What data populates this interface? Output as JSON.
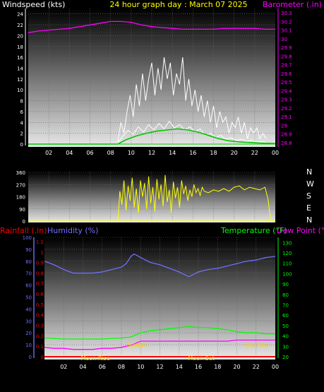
{
  "title": "24 hour graph day : March 07 2025",
  "colors": {
    "background": "#000000",
    "title": "#ffff00",
    "barometer": "#ff00ff",
    "windspeed": "#ffffff",
    "gust": "#ffffff",
    "avg_wind": "#00c800",
    "winddir": "#ffff00",
    "rainfall": "#ff0000",
    "humidity": "#6f6fff",
    "temperature": "#00ff00",
    "dewpoint": "#ff00ff",
    "events": "#ffcc00"
  },
  "chart_data": [
    {
      "type": "line",
      "name": "wind-barometer",
      "left_axis_label": "Windspeed (kts)",
      "right_axis_label": "Barometer (.in)",
      "x_ticks": [
        "02",
        "04",
        "06",
        "08",
        "10",
        "12",
        "14",
        "16",
        "18",
        "20",
        "22",
        "00"
      ],
      "y_left_ticks": [
        "0",
        "2",
        "4",
        "6",
        "8",
        "10",
        "12",
        "14",
        "16",
        "18",
        "20",
        "22",
        "24"
      ],
      "y_right_ticks": [
        "28.8",
        "28.9",
        "29",
        "29.1",
        "29.2",
        "29.3",
        "29.4",
        "29.5",
        "29.6",
        "29.7",
        "29.8",
        "29.9",
        "30",
        "30.1",
        "30.2",
        "30.3"
      ],
      "ylim_left": [
        0,
        25
      ],
      "ylim_right": [
        28.75,
        30.35
      ],
      "x_range": [
        0,
        24
      ],
      "series": [
        {
          "key": "barometer",
          "axis": "right",
          "x": [
            0,
            1,
            2,
            3,
            4,
            5,
            6,
            7,
            8,
            9,
            10,
            11,
            12,
            13,
            14,
            15,
            16,
            17,
            18,
            19,
            20,
            21,
            22,
            23,
            24
          ],
          "y": [
            30.07,
            30.09,
            30.1,
            30.11,
            30.12,
            30.14,
            30.16,
            30.18,
            30.2,
            30.2,
            30.19,
            30.16,
            30.14,
            30.13,
            30.12,
            30.11,
            30.11,
            30.11,
            30.11,
            30.12,
            30.12,
            30.12,
            30.12,
            30.11,
            30.11
          ]
        },
        {
          "key": "gust",
          "axis": "left",
          "x": [
            8.7,
            9.0,
            9.3,
            9.6,
            9.9,
            10.2,
            10.5,
            10.8,
            11.1,
            11.4,
            11.7,
            12.0,
            12.3,
            12.6,
            12.9,
            13.2,
            13.5,
            13.8,
            14.1,
            14.4,
            14.7,
            15.0,
            15.3,
            15.6,
            15.9,
            16.2,
            16.5,
            16.8,
            17.1,
            17.4,
            17.7,
            18.0,
            18.3,
            18.6,
            18.9,
            19.2,
            19.5,
            19.8,
            20.1,
            20.4,
            20.7,
            21.0,
            21.3,
            21.6,
            21.9,
            22.2,
            22.5,
            22.8,
            23.1
          ],
          "y": [
            0.5,
            4,
            2,
            6,
            9,
            5,
            11,
            7,
            13,
            8,
            12,
            15,
            9,
            14,
            10,
            16,
            12,
            15,
            9,
            13,
            11,
            16,
            8,
            12,
            7,
            10,
            6,
            9,
            5,
            8,
            4,
            7,
            3,
            6,
            4,
            5,
            2,
            4,
            3,
            5,
            2,
            4,
            1,
            3,
            2,
            3,
            1,
            2,
            1
          ]
        },
        {
          "key": "wind",
          "axis": "left",
          "x": [
            8.7,
            9.2,
            9.7,
            10.2,
            10.7,
            11.2,
            11.7,
            12.2,
            12.7,
            13.2,
            13.7,
            14.2,
            14.7,
            15.2,
            15.7,
            16.2,
            16.7,
            17.2,
            17.7,
            18.2,
            18.7,
            19.2,
            19.7,
            20.2,
            20.7,
            21.2,
            21.7,
            22.2,
            22.7,
            23.2
          ],
          "y": [
            0.3,
            1.5,
            2.5,
            1.8,
            3.2,
            2.2,
            3.6,
            2.6,
            3.8,
            2.8,
            4.2,
            3.0,
            3.6,
            2.6,
            3.2,
            2.2,
            2.8,
            1.6,
            2.0,
            1.2,
            1.6,
            0.9,
            1.2,
            0.7,
            0.9,
            0.5,
            0.7,
            0.4,
            0.5,
            0.2
          ]
        },
        {
          "key": "avg_wind",
          "axis": "left",
          "x": [
            0,
            8.7,
            9.5,
            10.5,
            11.5,
            12.5,
            13.5,
            14.5,
            15.5,
            16.5,
            17.5,
            18.5,
            19.5,
            20.5,
            21.5,
            22.5,
            24
          ],
          "y": [
            0,
            0,
            0.8,
            1.5,
            2.0,
            2.4,
            2.6,
            2.8,
            2.6,
            2.2,
            1.6,
            1.0,
            0.6,
            0.4,
            0.3,
            0.2,
            0.1
          ]
        }
      ]
    },
    {
      "type": "line",
      "name": "wind-direction",
      "y_ticks": [
        "0",
        "90",
        "180",
        "270",
        "360"
      ],
      "ylim": [
        0,
        360
      ],
      "compass_labels": [
        "N",
        "W",
        "S",
        "E",
        "N"
      ],
      "x_range": [
        0,
        24
      ],
      "series": [
        {
          "key": "winddir",
          "x": [
            8.7,
            8.9,
            9.1,
            9.3,
            9.5,
            9.7,
            9.9,
            10.1,
            10.3,
            10.5,
            10.7,
            10.9,
            11.1,
            11.3,
            11.5,
            11.7,
            11.9,
            12.1,
            12.3,
            12.5,
            12.7,
            12.9,
            13.1,
            13.3,
            13.5,
            13.7,
            13.9,
            14.1,
            14.3,
            14.5,
            14.7,
            14.9,
            15.1,
            15.3,
            15.5,
            15.7,
            15.9,
            16.1,
            16.3,
            16.5,
            16.7,
            16.9,
            17.1,
            17.5,
            18.0,
            18.5,
            19.0,
            19.5,
            20.0,
            20.5,
            21.0,
            21.5,
            22.0,
            22.5,
            23.0,
            23.3,
            23.5,
            23.7
          ],
          "y": [
            0,
            220,
            120,
            300,
            80,
            260,
            150,
            320,
            100,
            240,
            60,
            300,
            180,
            280,
            90,
            330,
            130,
            250,
            70,
            310,
            160,
            270,
            110,
            340,
            140,
            230,
            60,
            290,
            170,
            250,
            100,
            300,
            200,
            260,
            150,
            230,
            180,
            270,
            210,
            240,
            190,
            250,
            220,
            210,
            230,
            220,
            240,
            220,
            250,
            260,
            230,
            250,
            240,
            230,
            250,
            160,
            30,
            0
          ]
        }
      ]
    },
    {
      "type": "line",
      "name": "temp-humidity",
      "left_axis_labels": [
        "Rainfall (.in)",
        "Humidity (%)"
      ],
      "right_axis_labels": [
        "Temperature (°F)",
        "Dew Point (°F)"
      ],
      "x_ticks": [
        "02",
        "04",
        "06",
        "08",
        "10",
        "12",
        "14",
        "16",
        "18",
        "20",
        "22",
        "00"
      ],
      "y_humidity_ticks": [
        "0",
        "10",
        "20",
        "30",
        "40",
        "50",
        "60",
        "70",
        "80",
        "90",
        "100"
      ],
      "y_rain_ticks": [
        "0",
        "0.1",
        "0.2",
        "0.3",
        "0.4",
        "0.5",
        "0.6",
        "0.7",
        "0.8",
        "0.9",
        "1",
        "1.1"
      ],
      "y_temp_ticks": [
        "20",
        "30",
        "40",
        "50",
        "60",
        "70",
        "80",
        "90",
        "100",
        "110",
        "120",
        "130"
      ],
      "ylim_humidity": [
        0,
        100
      ],
      "ylim_rain": [
        0,
        1.14
      ],
      "ylim_temp": [
        20,
        135
      ],
      "x_range": [
        0,
        24
      ],
      "series": [
        {
          "key": "humidity",
          "axis": "humidity",
          "x": [
            0,
            1,
            2,
            3,
            4,
            5,
            6,
            7,
            8,
            8.5,
            9,
            9.3,
            9.6,
            10,
            10.5,
            11,
            12,
            13,
            14,
            14.5,
            15,
            15.5,
            16,
            17,
            18,
            19,
            20,
            21,
            22,
            23,
            24
          ],
          "y": [
            80,
            77,
            73,
            70,
            70,
            70,
            71,
            73,
            75,
            78,
            84,
            86,
            85,
            83,
            81,
            79,
            77,
            74,
            71,
            69,
            67,
            69,
            71,
            73,
            74,
            76,
            78,
            80,
            81,
            83,
            84
          ]
        },
        {
          "key": "temperature",
          "axis": "temp",
          "x": [
            0,
            2,
            4,
            6,
            8,
            9,
            10,
            11,
            12,
            13,
            14,
            15,
            16,
            17,
            18,
            19,
            20,
            21,
            22,
            23,
            24
          ],
          "y": [
            38,
            37,
            37,
            37,
            38,
            39,
            43,
            45,
            46,
            47,
            48,
            49,
            48,
            48,
            47,
            46,
            44,
            43,
            43,
            42,
            42
          ]
        },
        {
          "key": "dewpoint",
          "axis": "temp",
          "x": [
            0,
            1,
            2,
            3,
            4,
            5,
            6,
            7,
            8,
            9,
            10,
            11,
            12,
            13,
            14,
            15,
            16,
            17,
            18,
            19,
            20,
            21,
            22,
            23,
            24
          ],
          "y": [
            29,
            28,
            28,
            27,
            27,
            27,
            28,
            28,
            29,
            31,
            35,
            35,
            35,
            35,
            35,
            35,
            35,
            35,
            35,
            35,
            36,
            36,
            36,
            36,
            36
          ]
        },
        {
          "key": "rainfall",
          "axis": "rain",
          "x": [
            0,
            24
          ],
          "y": [
            0,
            0
          ]
        }
      ],
      "event_labels": [
        {
          "text": "SunSet",
          "row": "upper",
          "x": 9.6
        },
        {
          "text": "SunRise",
          "row": "upper",
          "x": 22.1
        },
        {
          "text": "Moon Rise",
          "row": "lower",
          "x": 5.3
        },
        {
          "text": "Moon Set",
          "row": "lower",
          "x": 16.3
        }
      ]
    }
  ]
}
